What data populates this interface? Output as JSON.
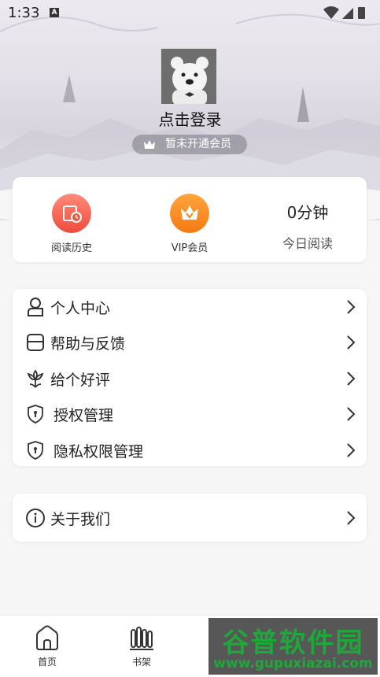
{
  "status_bar": {
    "time": "1:33",
    "notif_icon": "A"
  },
  "profile": {
    "login_text": "点击登录",
    "vip_status": "暂未开通会员"
  },
  "stats": {
    "history_label": "阅读历史",
    "vip_label": "VIP会员",
    "minutes_value": "0分钟",
    "today_label": "今日阅读"
  },
  "menu": {
    "items": [
      {
        "label": "个人中心",
        "icon": "person-icon"
      },
      {
        "label": "帮助与反馈",
        "icon": "feedback-icon"
      },
      {
        "label": "给个好评",
        "icon": "flower-icon"
      },
      {
        "label": "授权管理",
        "icon": "shield-icon"
      },
      {
        "label": "隐私权限管理",
        "icon": "shield-icon"
      }
    ],
    "about": {
      "label": "关于我们",
      "icon": "info-icon"
    }
  },
  "tabbar": {
    "tabs": [
      {
        "label": "首页",
        "icon": "home-icon"
      },
      {
        "label": "书架",
        "icon": "bookshelf-icon"
      }
    ]
  },
  "watermark": {
    "title": "谷普软件园",
    "url": "www.gupuxiazai.com"
  },
  "colors": {
    "history_red": "#f04e3e",
    "vip_orange": "#f7861c",
    "watermark_green": "#1fa83a"
  }
}
